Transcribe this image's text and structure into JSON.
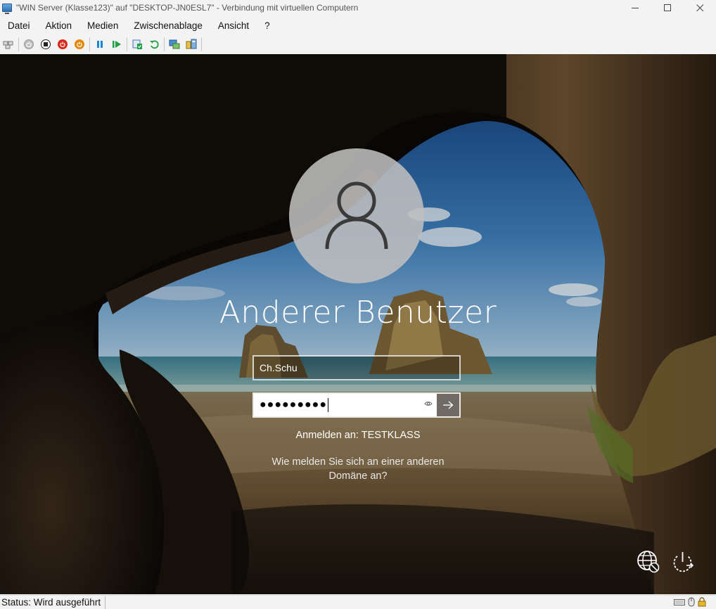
{
  "window": {
    "title": "\"WIN Server (Klasse123)\" auf \"DESKTOP-JN0ESL7\" - Verbindung mit virtuellen Computern",
    "minimize_icon": "minimize-icon",
    "maximize_icon": "maximize-icon",
    "close_icon": "close-icon"
  },
  "menu": {
    "items": [
      "Datei",
      "Aktion",
      "Medien",
      "Zwischenablage",
      "Ansicht",
      "?"
    ]
  },
  "toolbar": {
    "icons": [
      "ctrl-alt-del-icon",
      "start-icon",
      "turn-off-icon",
      "shutdown-icon",
      "power-icon",
      "pause-icon",
      "resume-icon",
      "checkpoint-icon",
      "revert-icon",
      "enhanced-session-icon",
      "share-icon"
    ]
  },
  "login": {
    "user_name": "Anderer Benutzer",
    "username_value": "Ch.Schu",
    "password_mask": "●●●●●●●●●",
    "sign_in_to": "Anmelden an: TESTKLASS",
    "other_domain_line1": "Wie melden Sie sich an einer anderen",
    "other_domain_line2": "Domäne an?"
  },
  "status": {
    "text": "Status: Wird ausgeführt"
  },
  "colors": {
    "chrome_bg": "#f3f3f3",
    "power_red": "#d9281c",
    "power_orange": "#e38a0e",
    "toolbar_blue": "#1a86d9",
    "toolbar_green": "#21a045"
  }
}
